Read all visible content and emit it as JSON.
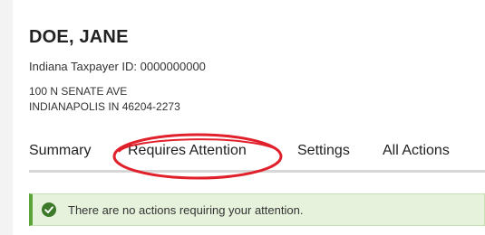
{
  "header": {
    "name": "DOE, JANE",
    "taxpayer_id": "Indiana Taxpayer ID: 0000000000",
    "address_line1": "100 N SENATE AVE",
    "address_line2": "INDIANAPOLIS IN 46204-2273"
  },
  "tabs": [
    {
      "label": "Summary"
    },
    {
      "label": "Requires Attention"
    },
    {
      "label": "Settings"
    },
    {
      "label": "All Actions"
    }
  ],
  "alert": {
    "message": "There are no actions requiring your attention.",
    "icon": "check-circle-icon",
    "color": "#5aa43a"
  },
  "annotation": {
    "color": "#e0202a"
  }
}
